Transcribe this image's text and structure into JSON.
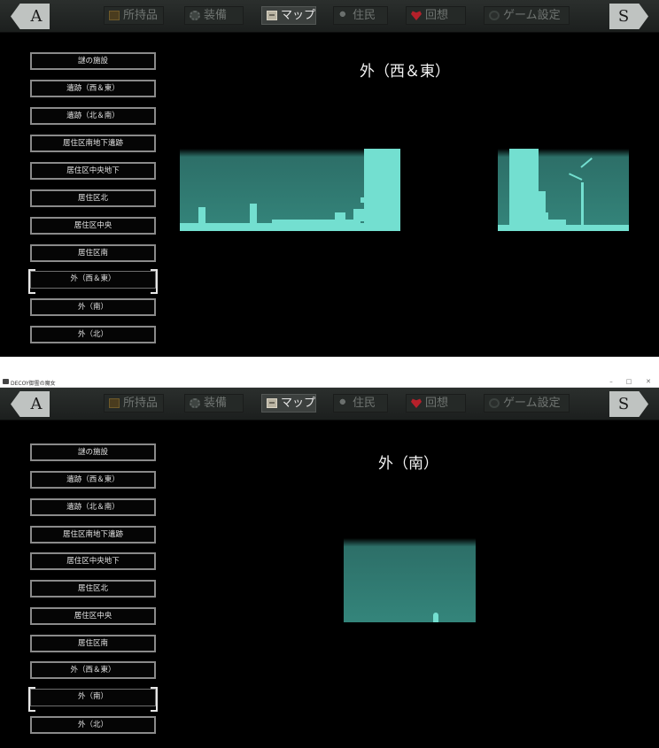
{
  "nav": {
    "prev_label": "A",
    "next_label": "S"
  },
  "tabs": {
    "inventory": {
      "label": "所持品",
      "icon": "bag-icon"
    },
    "equipment": {
      "label": "装備",
      "icon": "gear-icon"
    },
    "map": {
      "label": "マップ",
      "icon": "map-icon"
    },
    "residents": {
      "label": "住民",
      "icon": "person-icon"
    },
    "recollection": {
      "label": "回想",
      "icon": "heart-icon"
    },
    "settings": {
      "label": "ゲーム設定",
      "icon": "cog-icon"
    }
  },
  "areas": [
    "謎の施設",
    "遺跡（西＆東）",
    "遺跡（北＆南）",
    "居住区南地下遺跡",
    "居住区中央地下",
    "居住区北",
    "居住区中央",
    "居住区南",
    "外（西＆東）",
    "外（南）",
    "外（北）"
  ],
  "window": {
    "title": "DECOY御霊の魔女",
    "min": "–",
    "max": "□",
    "close": "✕"
  },
  "panels": [
    {
      "title": "外（西＆東）",
      "selected_index": 8
    },
    {
      "title": "外（南）",
      "selected_index": 9
    }
  ],
  "colors": {
    "map_dark": "#2d6f68",
    "map_light": "#73dfd0",
    "selected_frame": "#e6e6e6",
    "active_tab": "#3c403e"
  }
}
